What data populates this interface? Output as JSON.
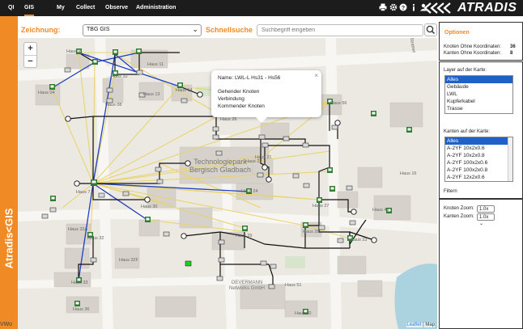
{
  "nav": {
    "items": [
      "QI",
      "GIS",
      "My",
      "Collect",
      "Observe",
      "Administration"
    ],
    "active": "GIS"
  },
  "brand": {
    "name": "ATRADIS",
    "accent": "#f08a24"
  },
  "sidebar": {
    "label": "Atradis<GIS"
  },
  "version": "VWo",
  "toolbar": {
    "drawing_label": "Zeichnung:",
    "drawing_value": "TBG GIS",
    "quicksearch_label": "Schnellsuche",
    "search_placeholder": "Suchbegriff eingeben"
  },
  "map": {
    "zoom_in": "+",
    "zoom_out": "−",
    "park_title": [
      "Technologiepark",
      "Bergisch Gladbach"
    ],
    "company": [
      "OEVERMANN",
      "Networks GmbH"
    ],
    "labels": [
      "Haus 9",
      "Haus 11",
      "Haus 04",
      "Haus 08",
      "Haus 13",
      "Haus 14",
      "Haus 10",
      "Haus 56",
      "Haus 16",
      "Haus 26",
      "Haus 21",
      "Haus 22",
      "Haus 7",
      "Haus 30",
      "Haus 24",
      "Haus 27",
      "Haus 46",
      "Haus 28",
      "Haus 23",
      "Haus 29",
      "Haus 32",
      "Haus 32A",
      "Haus 32F",
      "Haus 33",
      "Haus 36",
      "Haus 51",
      "Haus 50",
      "Strasse"
    ],
    "popup": {
      "title": "Name: LWL-L Hs31 - Hs56",
      "lines": [
        "Gehender Knoten",
        "Verbindung",
        "Kommender Knoten"
      ],
      "close": "×"
    },
    "attribution": [
      "Leaflet",
      "| Map"
    ]
  },
  "options": {
    "title": "Optionen",
    "stats": [
      {
        "label": "Knoten Ohne Koordinaten:",
        "value": "36"
      },
      {
        "label": "Kanten Ohne Koordinaten:",
        "value": "8"
      }
    ],
    "layer_label": "Layer auf der Karte:",
    "layers": [
      "Alles",
      "Gebäude",
      "LWL",
      "Kupferkabel",
      "Trasse"
    ],
    "edges_label": "Kanten auf der Karte:",
    "edges": [
      "Alles",
      "A-2YF 10x2x0.6",
      "A-2YF 10x2x0.8",
      "A-2YF 100x2x0.6",
      "A-2YF 100x2x0.8",
      "A-2YF 12x2x0.6"
    ],
    "filter_label": "Filtern",
    "node_zoom_label": "Knoten Zoom:",
    "node_zoom": "1.0x",
    "edge_zoom_label": "Kanten Zoom:",
    "edge_zoom": "1.0x"
  },
  "colors": {
    "yellow_edges": "#e8d36a",
    "blue_edges": "#1f3fc4",
    "black_edges": "#111111",
    "map_bg": "#ece9e3",
    "building": "#d6d2cb"
  }
}
